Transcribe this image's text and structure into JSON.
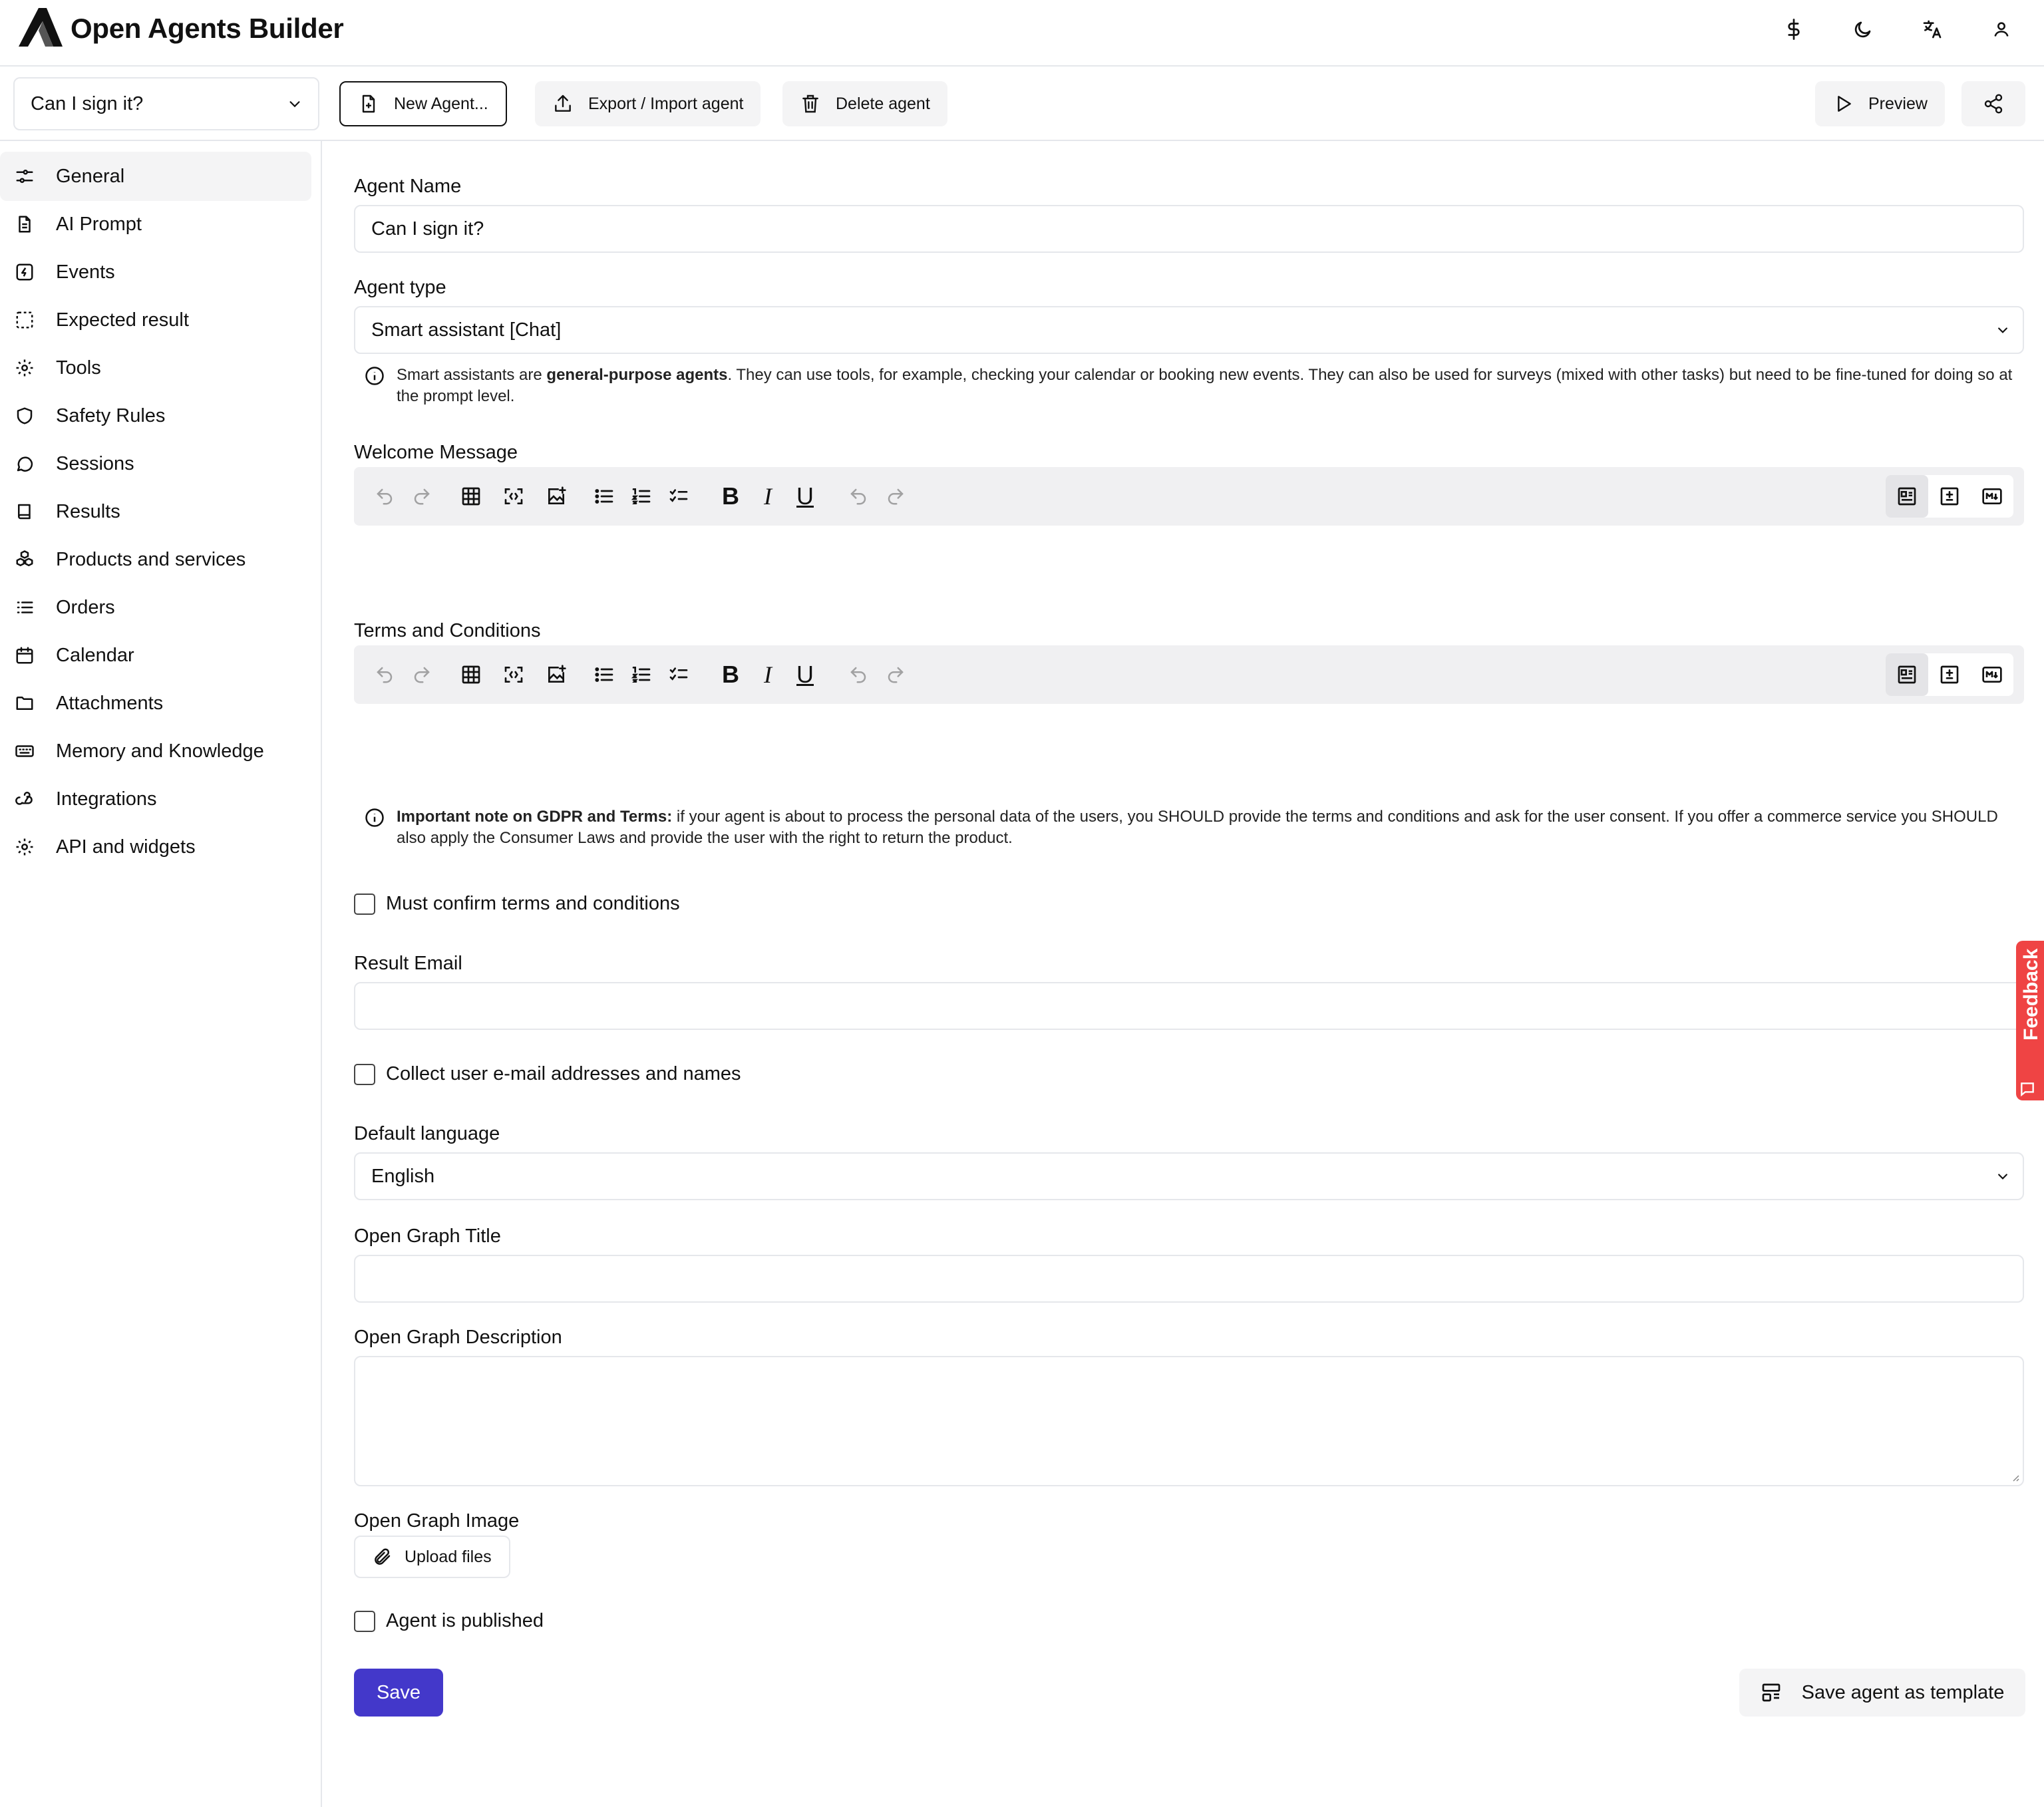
{
  "app": {
    "title": "Open Agents Builder"
  },
  "header": {
    "icons": [
      "dollar-icon",
      "moon-icon",
      "translate-icon",
      "user-icon"
    ]
  },
  "toolbar": {
    "agent_select_value": "Can I sign it?",
    "new_agent_label": "New Agent...",
    "export_import_label": "Export / Import agent",
    "delete_label": "Delete agent",
    "preview_label": "Preview"
  },
  "sidebar": {
    "items": [
      {
        "label": "General",
        "icon": "sliders-icon",
        "active": true
      },
      {
        "label": "AI Prompt",
        "icon": "document-icon"
      },
      {
        "label": "Events",
        "icon": "bolt-square-icon"
      },
      {
        "label": "Expected result",
        "icon": "dashed-square-icon"
      },
      {
        "label": "Tools",
        "icon": "gear-icon"
      },
      {
        "label": "Safety Rules",
        "icon": "shield-icon"
      },
      {
        "label": "Sessions",
        "icon": "chat-bubble-icon"
      },
      {
        "label": "Results",
        "icon": "book-icon"
      },
      {
        "label": "Products and services",
        "icon": "cubes-icon"
      },
      {
        "label": "Orders",
        "icon": "list-icon"
      },
      {
        "label": "Calendar",
        "icon": "calendar-icon"
      },
      {
        "label": "Attachments",
        "icon": "folder-icon"
      },
      {
        "label": "Memory and Knowledge",
        "icon": "keyboard-icon"
      },
      {
        "label": "Integrations",
        "icon": "webhook-icon"
      },
      {
        "label": "API and widgets",
        "icon": "gear-icon"
      }
    ]
  },
  "form": {
    "agent_name": {
      "label": "Agent Name",
      "value": "Can I sign it?"
    },
    "agent_type": {
      "label": "Agent type",
      "value": "Smart assistant [Chat]",
      "help_prefix": "Smart assistants are ",
      "help_bold": "general-purpose agents",
      "help_suffix": ". They can use tools, for example, checking your calendar or booking new events. They can also be used for surveys (mixed with other tasks) but need to be fine-tuned for doing so at the prompt level."
    },
    "welcome_message": {
      "label": "Welcome Message",
      "value": ""
    },
    "terms": {
      "label": "Terms and Conditions",
      "value": ""
    },
    "gdpr_note": {
      "bold": "Important note on GDPR and Terms:",
      "text": " if your agent is about to process the personal data of the users, you SHOULD provide the terms and conditions and ask for the user consent. If you offer a commerce service you SHOULD also apply the Consumer Laws and provide the user with the right to return the product."
    },
    "must_confirm": {
      "label": "Must confirm terms and conditions",
      "checked": false
    },
    "result_email": {
      "label": "Result Email",
      "value": ""
    },
    "collect_emails": {
      "label": "Collect user e-mail addresses and names",
      "checked": false
    },
    "default_language": {
      "label": "Default language",
      "value": "English"
    },
    "og_title": {
      "label": "Open Graph Title",
      "value": ""
    },
    "og_description": {
      "label": "Open Graph Description",
      "value": ""
    },
    "og_image": {
      "label": "Open Graph Image",
      "upload_label": "Upload files"
    },
    "published": {
      "label": "Agent is published",
      "checked": false
    },
    "save_label": "Save",
    "save_template_label": "Save agent as template"
  },
  "feedback": {
    "label": "Feedback"
  },
  "colors": {
    "primary": "#4338ca",
    "feedback": "#ef4444",
    "muted_bg": "#f4f4f5",
    "border": "#e5e7eb"
  }
}
